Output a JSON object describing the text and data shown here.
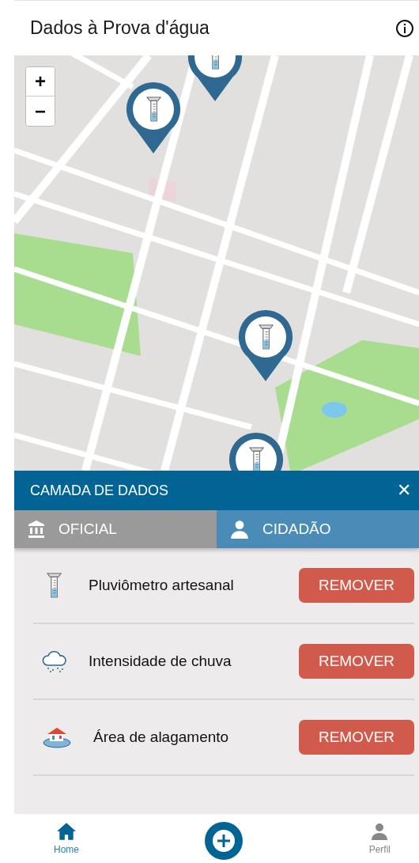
{
  "header": {
    "title": "Dados à Prova d'água"
  },
  "map": {
    "zoom_in": "+",
    "zoom_out": "−"
  },
  "panel": {
    "title": "CAMADA DE DADOS",
    "close": "✕",
    "tabs": [
      {
        "label": "OFICIAL",
        "kind": "institution",
        "selected": false
      },
      {
        "label": "CIDADÃO",
        "kind": "person",
        "selected": true
      }
    ],
    "layers": [
      {
        "kind": "gauge",
        "label": "Pluviômetro artesanal",
        "action": "REMOVER"
      },
      {
        "kind": "rain",
        "label": "Intensidade de chuva",
        "action": "REMOVER"
      },
      {
        "kind": "flood",
        "label": "Área de alagamento",
        "action": "REMOVER"
      }
    ]
  },
  "nav": [
    {
      "kind": "home",
      "label": "Home",
      "selected": true
    },
    {
      "kind": "add"
    },
    {
      "kind": "profile",
      "label": "Perfil",
      "selected": false
    }
  ]
}
